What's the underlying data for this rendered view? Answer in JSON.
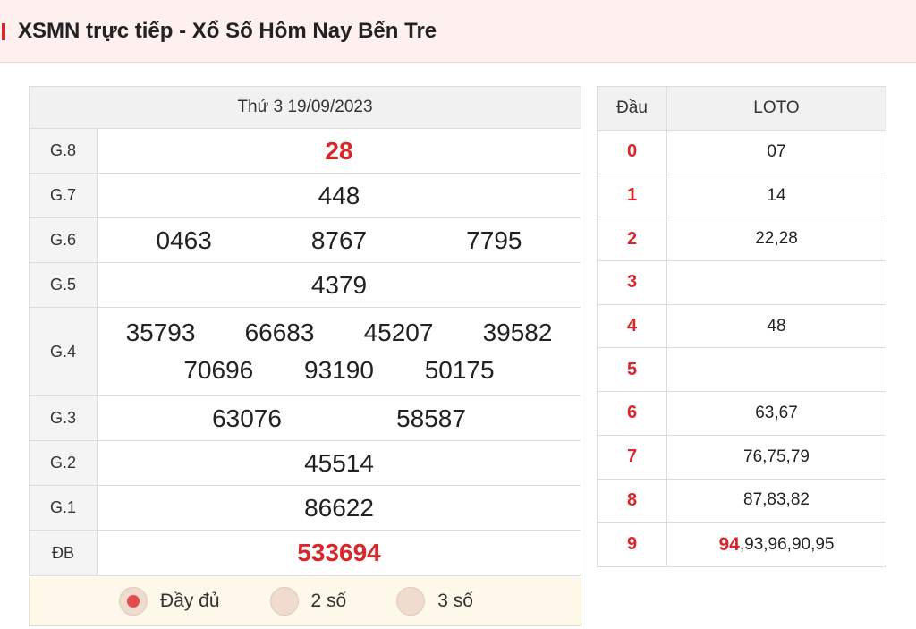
{
  "header": {
    "title": "XSMN trực tiếp - Xổ Số Hôm Nay Bến Tre"
  },
  "results": {
    "date": "Thứ 3 19/09/2023",
    "rows": {
      "g8": {
        "label": "G.8",
        "numbers": [
          "28"
        ]
      },
      "g7": {
        "label": "G.7",
        "numbers": [
          "448"
        ]
      },
      "g6": {
        "label": "G.6",
        "numbers": [
          "0463",
          "8767",
          "7795"
        ]
      },
      "g5": {
        "label": "G.5",
        "numbers": [
          "4379"
        ]
      },
      "g4": {
        "label": "G.4",
        "numbers": [
          "35793",
          "66683",
          "45207",
          "39582",
          "70696",
          "93190",
          "50175"
        ]
      },
      "g3": {
        "label": "G.3",
        "numbers": [
          "63076",
          "58587"
        ]
      },
      "g2": {
        "label": "G.2",
        "numbers": [
          "45514"
        ]
      },
      "g1": {
        "label": "G.1",
        "numbers": [
          "86622"
        ]
      },
      "db": {
        "label": "ĐB",
        "numbers": [
          "533694"
        ]
      }
    },
    "accent_color": "#d9262a"
  },
  "options": [
    {
      "label": "Đầy đủ",
      "selected": true
    },
    {
      "label": "2 số",
      "selected": false
    },
    {
      "label": "3 số",
      "selected": false
    }
  ],
  "loto": {
    "head_dau": "Đầu",
    "head_loto": "LOTO",
    "rows": [
      {
        "dau": "0",
        "highlight": "",
        "rest": "07"
      },
      {
        "dau": "1",
        "highlight": "",
        "rest": "14"
      },
      {
        "dau": "2",
        "highlight": "",
        "rest": "22,28"
      },
      {
        "dau": "3",
        "highlight": "",
        "rest": ""
      },
      {
        "dau": "4",
        "highlight": "",
        "rest": "48"
      },
      {
        "dau": "5",
        "highlight": "",
        "rest": ""
      },
      {
        "dau": "6",
        "highlight": "",
        "rest": "63,67"
      },
      {
        "dau": "7",
        "highlight": "",
        "rest": "76,75,79"
      },
      {
        "dau": "8",
        "highlight": "",
        "rest": "87,83,82"
      },
      {
        "dau": "9",
        "highlight": "94",
        "rest": ",93,96,90,95"
      }
    ]
  }
}
